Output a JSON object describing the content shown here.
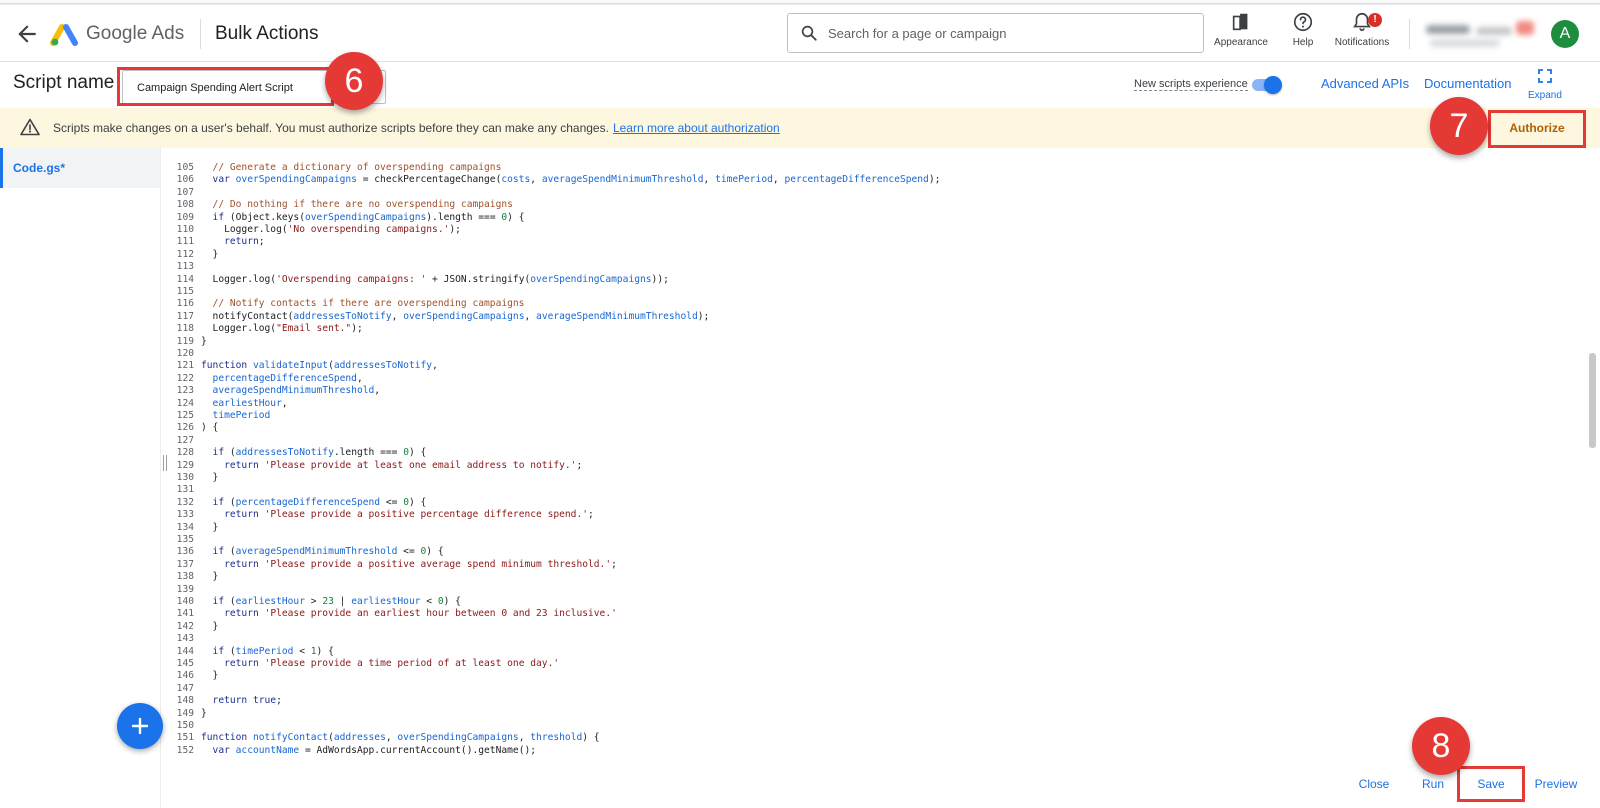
{
  "header": {
    "product_name": "Google Ads",
    "page_title": "Bulk Actions",
    "search_placeholder": "Search for a page or campaign",
    "appearance_label": "Appearance",
    "help_label": "Help",
    "notifications_label": "Notifications",
    "notifications_badge": "!",
    "avatar_letter": "A"
  },
  "editor_header": {
    "script_name_label": "Script name",
    "script_name_value": "Campaign Spending Alert Script",
    "new_experience_label": "New scripts experience",
    "new_experience_enabled": true,
    "advanced_apis_label": "Advanced APIs",
    "documentation_label": "Documentation",
    "expand_label": "Expand"
  },
  "banner": {
    "message": "Scripts make changes on a user's behalf. You must authorize scripts before they can make any changes.",
    "link_text": "Learn more about authorization",
    "authorize_label": "Authorize"
  },
  "sidebar": {
    "file_name": "Code.gs*"
  },
  "code_lines": [
    {
      "n": "105",
      "segs": [
        [
          "cm",
          "  // Generate a dictionary of overspending campaigns"
        ]
      ]
    },
    {
      "n": "106",
      "segs": [
        [
          "kw",
          "  var "
        ],
        [
          "var",
          "overSpendingCampaigns"
        ],
        [
          "",
          " = checkPercentageChange("
        ],
        [
          "var",
          "costs"
        ],
        [
          "",
          ", "
        ],
        [
          "var",
          "averageSpendMinimumThreshold"
        ],
        [
          "",
          ", "
        ],
        [
          "var",
          "timePeriod"
        ],
        [
          "",
          ", "
        ],
        [
          "var",
          "percentageDifferenceSpend"
        ],
        [
          "",
          ");"
        ]
      ]
    },
    {
      "n": "107",
      "segs": [
        [
          "",
          ""
        ]
      ]
    },
    {
      "n": "108",
      "segs": [
        [
          "cm",
          "  // Do nothing if there are no overspending campaigns"
        ]
      ]
    },
    {
      "n": "109",
      "segs": [
        [
          "kw",
          "  if "
        ],
        [
          "",
          "(Object.keys("
        ],
        [
          "var",
          "overSpendingCampaigns"
        ],
        [
          "",
          ").length === "
        ],
        [
          "num",
          "0"
        ],
        [
          "",
          ") {"
        ]
      ]
    },
    {
      "n": "110",
      "segs": [
        [
          "",
          "    Logger.log("
        ],
        [
          "str",
          "'No overspending campaigns.'"
        ],
        [
          "",
          ");"
        ]
      ]
    },
    {
      "n": "111",
      "segs": [
        [
          "kw",
          "    return"
        ],
        [
          "",
          ";"
        ]
      ]
    },
    {
      "n": "112",
      "segs": [
        [
          "",
          "  }"
        ]
      ]
    },
    {
      "n": "113",
      "segs": [
        [
          "",
          ""
        ]
      ]
    },
    {
      "n": "114",
      "segs": [
        [
          "",
          "  Logger.log("
        ],
        [
          "str",
          "'Overspending campaigns: '"
        ],
        [
          "",
          " + JSON.stringify("
        ],
        [
          "var",
          "overSpendingCampaigns"
        ],
        [
          "",
          "));"
        ]
      ]
    },
    {
      "n": "115",
      "segs": [
        [
          "",
          ""
        ]
      ]
    },
    {
      "n": "116",
      "segs": [
        [
          "cm",
          "  // Notify contacts if there are overspending campaigns"
        ]
      ]
    },
    {
      "n": "117",
      "segs": [
        [
          "",
          "  notifyContact("
        ],
        [
          "var",
          "addressesToNotify"
        ],
        [
          "",
          ", "
        ],
        [
          "var",
          "overSpendingCampaigns"
        ],
        [
          "",
          ", "
        ],
        [
          "var",
          "averageSpendMinimumThreshold"
        ],
        [
          "",
          ");"
        ]
      ]
    },
    {
      "n": "118",
      "segs": [
        [
          "",
          "  Logger.log("
        ],
        [
          "str",
          "\"Email sent.\""
        ],
        [
          "",
          ");"
        ]
      ]
    },
    {
      "n": "119",
      "segs": [
        [
          "",
          "}"
        ]
      ]
    },
    {
      "n": "120",
      "segs": [
        [
          "",
          ""
        ]
      ]
    },
    {
      "n": "121",
      "segs": [
        [
          "kw",
          "function "
        ],
        [
          "var",
          "validateInput"
        ],
        [
          "",
          "("
        ],
        [
          "var",
          "addressesToNotify"
        ],
        [
          "",
          ","
        ]
      ]
    },
    {
      "n": "122",
      "segs": [
        [
          "var",
          "  percentageDifferenceSpend"
        ],
        [
          "",
          ","
        ]
      ]
    },
    {
      "n": "123",
      "segs": [
        [
          "var",
          "  averageSpendMinimumThreshold"
        ],
        [
          "",
          ","
        ]
      ]
    },
    {
      "n": "124",
      "segs": [
        [
          "var",
          "  earliestHour"
        ],
        [
          "",
          ","
        ]
      ]
    },
    {
      "n": "125",
      "segs": [
        [
          "var",
          "  timePeriod"
        ]
      ]
    },
    {
      "n": "126",
      "segs": [
        [
          "",
          ") {"
        ]
      ]
    },
    {
      "n": "127",
      "segs": [
        [
          "",
          ""
        ]
      ]
    },
    {
      "n": "128",
      "segs": [
        [
          "kw",
          "  if "
        ],
        [
          "",
          "("
        ],
        [
          "var",
          "addressesToNotify"
        ],
        [
          "",
          ".length === "
        ],
        [
          "num",
          "0"
        ],
        [
          "",
          ") {"
        ]
      ]
    },
    {
      "n": "129",
      "segs": [
        [
          "kw",
          "    return "
        ],
        [
          "str",
          "'Please provide at least one email address to notify.'"
        ],
        [
          "",
          ";"
        ]
      ]
    },
    {
      "n": "130",
      "segs": [
        [
          "",
          "  }"
        ]
      ]
    },
    {
      "n": "131",
      "segs": [
        [
          "",
          ""
        ]
      ]
    },
    {
      "n": "132",
      "segs": [
        [
          "kw",
          "  if "
        ],
        [
          "",
          "("
        ],
        [
          "var",
          "percentageDifferenceSpend"
        ],
        [
          "",
          " <= "
        ],
        [
          "num",
          "0"
        ],
        [
          "",
          ") {"
        ]
      ]
    },
    {
      "n": "133",
      "segs": [
        [
          "kw",
          "    return "
        ],
        [
          "str",
          "'Please provide a positive percentage difference spend.'"
        ],
        [
          "",
          ";"
        ]
      ]
    },
    {
      "n": "134",
      "segs": [
        [
          "",
          "  }"
        ]
      ]
    },
    {
      "n": "135",
      "segs": [
        [
          "",
          ""
        ]
      ]
    },
    {
      "n": "136",
      "segs": [
        [
          "kw",
          "  if "
        ],
        [
          "",
          "("
        ],
        [
          "var",
          "averageSpendMinimumThreshold"
        ],
        [
          "",
          " <= "
        ],
        [
          "num",
          "0"
        ],
        [
          "",
          ") {"
        ]
      ]
    },
    {
      "n": "137",
      "segs": [
        [
          "kw",
          "    return "
        ],
        [
          "str",
          "'Please provide a positive average spend minimum threshold.'"
        ],
        [
          "",
          ";"
        ]
      ]
    },
    {
      "n": "138",
      "segs": [
        [
          "",
          "  }"
        ]
      ]
    },
    {
      "n": "139",
      "segs": [
        [
          "",
          ""
        ]
      ]
    },
    {
      "n": "140",
      "segs": [
        [
          "kw",
          "  if "
        ],
        [
          "",
          "("
        ],
        [
          "var",
          "earliestHour"
        ],
        [
          "",
          " > "
        ],
        [
          "num",
          "23"
        ],
        [
          "",
          " | "
        ],
        [
          "var",
          "earliestHour"
        ],
        [
          "",
          " < "
        ],
        [
          "num",
          "0"
        ],
        [
          "",
          ") {"
        ]
      ]
    },
    {
      "n": "141",
      "segs": [
        [
          "kw",
          "    return "
        ],
        [
          "str",
          "'Please provide an earliest hour between 0 and 23 inclusive.'"
        ]
      ]
    },
    {
      "n": "142",
      "segs": [
        [
          "",
          "  }"
        ]
      ]
    },
    {
      "n": "143",
      "segs": [
        [
          "",
          ""
        ]
      ]
    },
    {
      "n": "144",
      "segs": [
        [
          "kw",
          "  if "
        ],
        [
          "",
          "("
        ],
        [
          "var",
          "timePeriod"
        ],
        [
          "",
          " < "
        ],
        [
          "num",
          "1"
        ],
        [
          "",
          ") {"
        ]
      ]
    },
    {
      "n": "145",
      "segs": [
        [
          "kw",
          "    return "
        ],
        [
          "str",
          "'Please provide a time period of at least one day.'"
        ]
      ]
    },
    {
      "n": "146",
      "segs": [
        [
          "",
          "  }"
        ]
      ]
    },
    {
      "n": "147",
      "segs": [
        [
          "",
          ""
        ]
      ]
    },
    {
      "n": "148",
      "segs": [
        [
          "kw",
          "  return true"
        ],
        [
          "",
          ";"
        ]
      ]
    },
    {
      "n": "149",
      "segs": [
        [
          "",
          "}"
        ]
      ]
    },
    {
      "n": "150",
      "segs": [
        [
          "",
          ""
        ]
      ]
    },
    {
      "n": "151",
      "segs": [
        [
          "kw",
          "function "
        ],
        [
          "var",
          "notifyContact"
        ],
        [
          "",
          "("
        ],
        [
          "var",
          "addresses"
        ],
        [
          "",
          ", "
        ],
        [
          "var",
          "overSpendingCampaigns"
        ],
        [
          "",
          ", "
        ],
        [
          "var",
          "threshold"
        ],
        [
          "",
          ") {"
        ]
      ]
    },
    {
      "n": "152",
      "segs": [
        [
          "kw",
          "  var "
        ],
        [
          "var",
          "accountName"
        ],
        [
          "",
          " = AdWordsApp.currentAccount().getName();"
        ]
      ]
    }
  ],
  "actions": {
    "close_label": "Close",
    "run_label": "Run",
    "save_label": "Save",
    "preview_label": "Preview"
  },
  "annotations": {
    "step_6": "6",
    "step_7": "7",
    "step_8": "8",
    "color": "#e53935"
  },
  "colors": {
    "accent": "#1a73e8",
    "banner_bg": "#fef7e0",
    "authorize_text": "#b06000"
  }
}
